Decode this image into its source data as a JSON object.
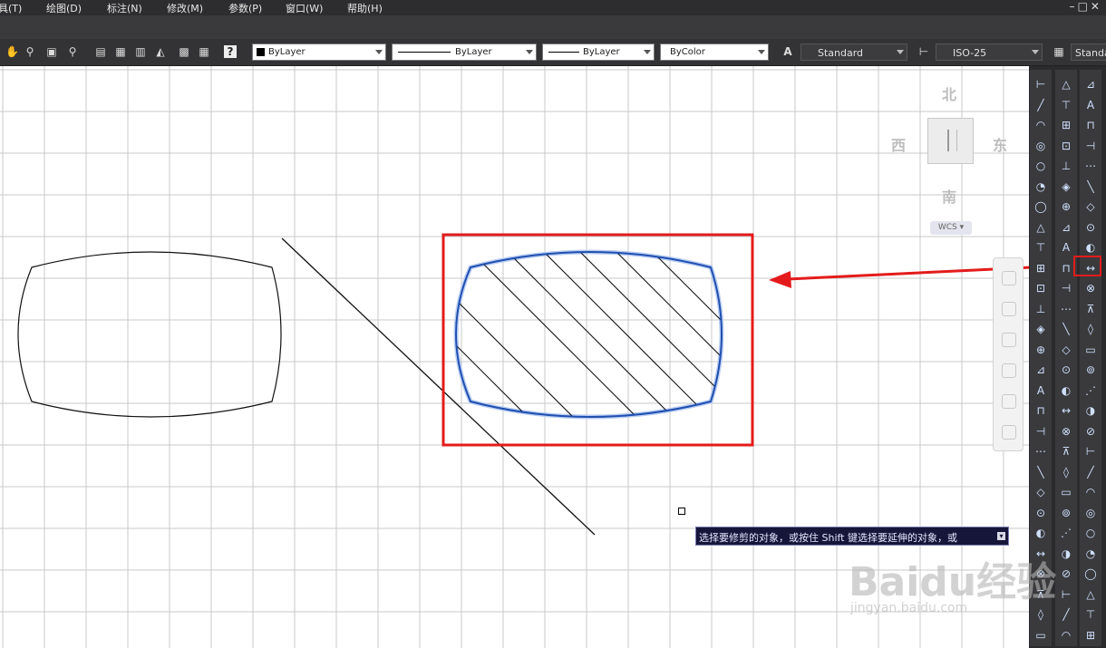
{
  "menu": {
    "items": [
      "具(T)",
      "绘图(D)",
      "标注(N)",
      "修改(M)",
      "参数(P)",
      "窗口(W)",
      "帮助(H)"
    ],
    "window_controls": "–□✕"
  },
  "toolbar": {
    "layer_combo": "ByLayer",
    "linetype_combo": "ByLayer",
    "lineweight_combo": "ByLayer",
    "plotstyle_combo": "ByColor",
    "text_style_combo": "Standard",
    "dim_style_combo": "ISO-25",
    "table_style_combo": "Standa"
  },
  "viewcube": {
    "north": "北",
    "south": "南",
    "east": "东",
    "west": "西",
    "wcs": "WCS"
  },
  "command_tooltip": "选择要修剪的对象，或按住 Shift 键选择要延伸的对象，或",
  "watermark": {
    "main": "Baidu经验",
    "url": "jingyan.baidu.com"
  },
  "colors": {
    "annotation_red": "#e41b1b",
    "hatch_blue": "#1f4fb0",
    "grid": "#c8c8c8"
  }
}
